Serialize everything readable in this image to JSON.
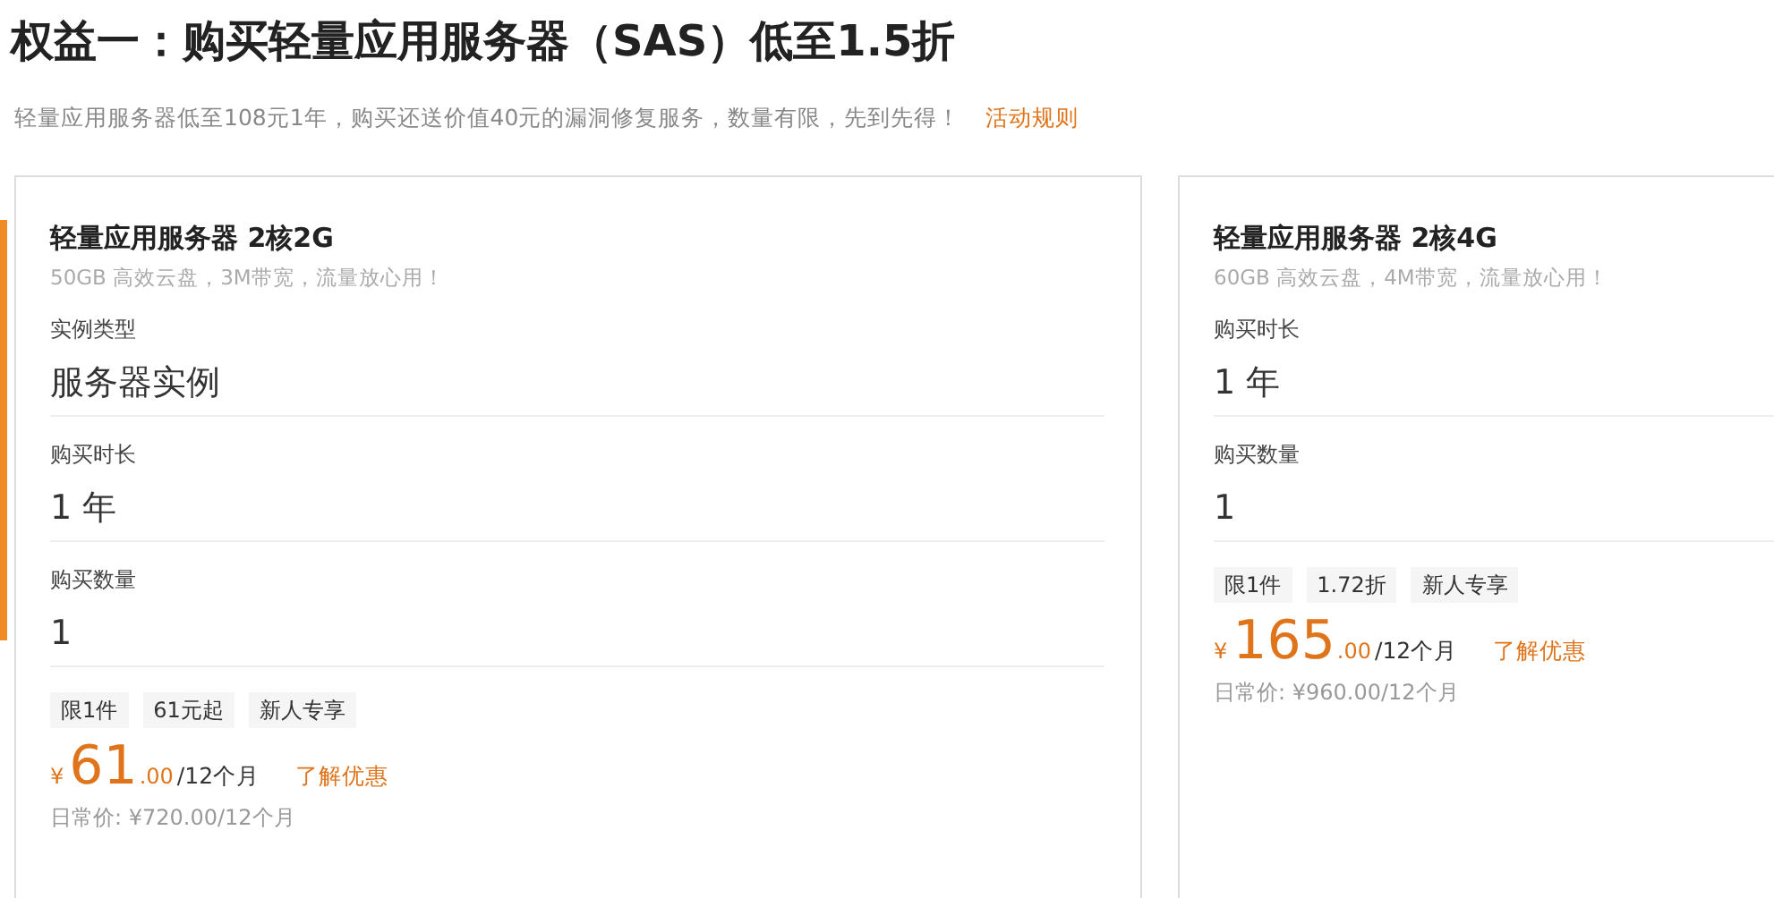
{
  "title": "权益一：购买轻量应用服务器（SAS）低至1.5折",
  "intro": {
    "text": "轻量应用服务器低至108元1年，购买还送价值40元的漏洞修复服务，数量有限，先到先得！",
    "link": "活动规则"
  },
  "cards": [
    {
      "name": "轻量应用服务器 2核2G",
      "desc": "50GB 高效云盘，3M带宽，流量放心用！",
      "fields": [
        {
          "label": "实例类型",
          "value": "服务器实例"
        },
        {
          "label": "购买时长",
          "value": "1 年"
        },
        {
          "label": "购买数量",
          "value": "1"
        }
      ],
      "tags": [
        "限1件",
        "61元起",
        "新人专享"
      ],
      "currency": "¥",
      "price": "61",
      "decimals": ".00",
      "period": "/12个月",
      "offer_link": "了解优惠",
      "regular_price": "日常价: ¥720.00/12个月"
    },
    {
      "name": "轻量应用服务器 2核4G",
      "desc": "60GB 高效云盘，4M带宽，流量放心用！",
      "fields": [
        {
          "label": "购买时长",
          "value": "1 年"
        },
        {
          "label": "购买数量",
          "value": "1"
        }
      ],
      "tags": [
        "限1件",
        "1.72折",
        "新人专享"
      ],
      "currency": "¥",
      "price": "165",
      "decimals": ".00",
      "period": "/12个月",
      "offer_link": "了解优惠",
      "regular_price": "日常价: ¥960.00/12个月"
    }
  ]
}
